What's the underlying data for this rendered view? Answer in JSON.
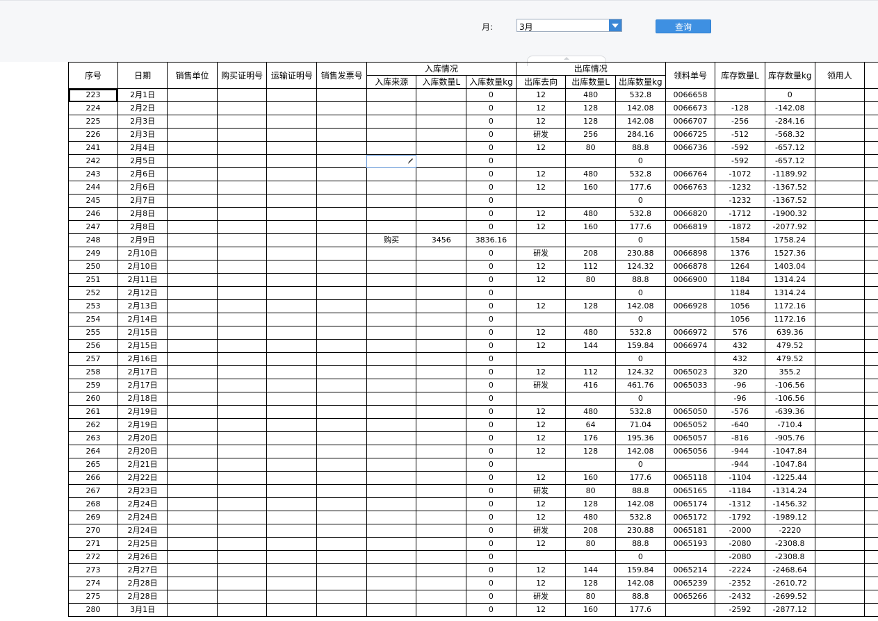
{
  "toolbar": {
    "month_label": "月:",
    "month_value": "3月",
    "query_label": "查询"
  },
  "headers": {
    "seq": "序号",
    "date": "日期",
    "sales_unit": "销售单位",
    "purchase_cert": "购买证明号",
    "transport_cert": "运输证明号",
    "invoice": "销售发票号",
    "inbound_group": "入库情况",
    "inbound_source": "入库来源",
    "inbound_qty_l": "入库数量L",
    "inbound_qty_kg": "入库数量kg",
    "outbound_group": "出库情况",
    "outbound_dest": "出库去向",
    "outbound_qty_l": "出库数量L",
    "outbound_qty_kg": "出库数量kg",
    "requisition": "领料单号",
    "stock_l": "库存数量L",
    "stock_kg": "库存数量kg",
    "receiver": "领用人"
  },
  "rows": [
    {
      "seq": "223",
      "date": "2月1日",
      "in_src": "",
      "in_l": "",
      "in_kg": "0",
      "out_dest": "12",
      "out_l": "480",
      "out_kg": "532.8",
      "req": "0066658",
      "stock_l": "",
      "stock_kg": "0"
    },
    {
      "seq": "224",
      "date": "2月2日",
      "in_src": "",
      "in_l": "",
      "in_kg": "0",
      "out_dest": "12",
      "out_l": "128",
      "out_kg": "142.08",
      "req": "0066673",
      "stock_l": "-128",
      "stock_kg": "-142.08"
    },
    {
      "seq": "225",
      "date": "2月3日",
      "in_src": "",
      "in_l": "",
      "in_kg": "0",
      "out_dest": "12",
      "out_l": "128",
      "out_kg": "142.08",
      "req": "0066707",
      "stock_l": "-256",
      "stock_kg": "-284.16"
    },
    {
      "seq": "226",
      "date": "2月3日",
      "in_src": "",
      "in_l": "",
      "in_kg": "0",
      "out_dest": "研发",
      "out_l": "256",
      "out_kg": "284.16",
      "req": "0066725",
      "stock_l": "-512",
      "stock_kg": "-568.32"
    },
    {
      "seq": "241",
      "date": "2月4日",
      "in_src": "",
      "in_l": "",
      "in_kg": "0",
      "out_dest": "12",
      "out_l": "80",
      "out_kg": "88.8",
      "req": "0066736",
      "stock_l": "-592",
      "stock_kg": "-657.12"
    },
    {
      "seq": "242",
      "date": "2月5日",
      "in_src": "",
      "in_l": "",
      "in_kg": "0",
      "out_dest": "",
      "out_l": "",
      "out_kg": "0",
      "req": "",
      "stock_l": "-592",
      "stock_kg": "-657.12"
    },
    {
      "seq": "243",
      "date": "2月6日",
      "in_src": "",
      "in_l": "",
      "in_kg": "0",
      "out_dest": "12",
      "out_l": "480",
      "out_kg": "532.8",
      "req": "0066764",
      "stock_l": "-1072",
      "stock_kg": "-1189.92"
    },
    {
      "seq": "244",
      "date": "2月6日",
      "in_src": "",
      "in_l": "",
      "in_kg": "0",
      "out_dest": "12",
      "out_l": "160",
      "out_kg": "177.6",
      "req": "0066763",
      "stock_l": "-1232",
      "stock_kg": "-1367.52"
    },
    {
      "seq": "245",
      "date": "2月7日",
      "in_src": "",
      "in_l": "",
      "in_kg": "0",
      "out_dest": "",
      "out_l": "",
      "out_kg": "0",
      "req": "",
      "stock_l": "-1232",
      "stock_kg": "-1367.52"
    },
    {
      "seq": "246",
      "date": "2月8日",
      "in_src": "",
      "in_l": "",
      "in_kg": "0",
      "out_dest": "12",
      "out_l": "480",
      "out_kg": "532.8",
      "req": "0066820",
      "stock_l": "-1712",
      "stock_kg": "-1900.32"
    },
    {
      "seq": "247",
      "date": "2月8日",
      "in_src": "",
      "in_l": "",
      "in_kg": "0",
      "out_dest": "12",
      "out_l": "160",
      "out_kg": "177.6",
      "req": "0066819",
      "stock_l": "-1872",
      "stock_kg": "-2077.92"
    },
    {
      "seq": "248",
      "date": "2月9日",
      "in_src": "购买",
      "in_l": "3456",
      "in_kg": "3836.16",
      "out_dest": "",
      "out_l": "",
      "out_kg": "0",
      "req": "",
      "stock_l": "1584",
      "stock_kg": "1758.24"
    },
    {
      "seq": "249",
      "date": "2月10日",
      "in_src": "",
      "in_l": "",
      "in_kg": "0",
      "out_dest": "研发",
      "out_l": "208",
      "out_kg": "230.88",
      "req": "0066898",
      "stock_l": "1376",
      "stock_kg": "1527.36"
    },
    {
      "seq": "250",
      "date": "2月10日",
      "in_src": "",
      "in_l": "",
      "in_kg": "0",
      "out_dest": "12",
      "out_l": "112",
      "out_kg": "124.32",
      "req": "0066878",
      "stock_l": "1264",
      "stock_kg": "1403.04"
    },
    {
      "seq": "251",
      "date": "2月11日",
      "in_src": "",
      "in_l": "",
      "in_kg": "0",
      "out_dest": "12",
      "out_l": "80",
      "out_kg": "88.8",
      "req": "0066900",
      "stock_l": "1184",
      "stock_kg": "1314.24"
    },
    {
      "seq": "252",
      "date": "2月12日",
      "in_src": "",
      "in_l": "",
      "in_kg": "0",
      "out_dest": "",
      "out_l": "",
      "out_kg": "0",
      "req": "",
      "stock_l": "1184",
      "stock_kg": "1314.24"
    },
    {
      "seq": "253",
      "date": "2月13日",
      "in_src": "",
      "in_l": "",
      "in_kg": "0",
      "out_dest": "12",
      "out_l": "128",
      "out_kg": "142.08",
      "req": "0066928",
      "stock_l": "1056",
      "stock_kg": "1172.16"
    },
    {
      "seq": "254",
      "date": "2月14日",
      "in_src": "",
      "in_l": "",
      "in_kg": "0",
      "out_dest": "",
      "out_l": "",
      "out_kg": "0",
      "req": "",
      "stock_l": "1056",
      "stock_kg": "1172.16"
    },
    {
      "seq": "255",
      "date": "2月15日",
      "in_src": "",
      "in_l": "",
      "in_kg": "0",
      "out_dest": "12",
      "out_l": "480",
      "out_kg": "532.8",
      "req": "0066972",
      "stock_l": "576",
      "stock_kg": "639.36"
    },
    {
      "seq": "256",
      "date": "2月15日",
      "in_src": "",
      "in_l": "",
      "in_kg": "0",
      "out_dest": "12",
      "out_l": "144",
      "out_kg": "159.84",
      "req": "0066974",
      "stock_l": "432",
      "stock_kg": "479.52"
    },
    {
      "seq": "257",
      "date": "2月16日",
      "in_src": "",
      "in_l": "",
      "in_kg": "0",
      "out_dest": "",
      "out_l": "",
      "out_kg": "0",
      "req": "",
      "stock_l": "432",
      "stock_kg": "479.52"
    },
    {
      "seq": "258",
      "date": "2月17日",
      "in_src": "",
      "in_l": "",
      "in_kg": "0",
      "out_dest": "12",
      "out_l": "112",
      "out_kg": "124.32",
      "req": "0065023",
      "stock_l": "320",
      "stock_kg": "355.2"
    },
    {
      "seq": "259",
      "date": "2月17日",
      "in_src": "",
      "in_l": "",
      "in_kg": "0",
      "out_dest": "研发",
      "out_l": "416",
      "out_kg": "461.76",
      "req": "0065033",
      "stock_l": "-96",
      "stock_kg": "-106.56"
    },
    {
      "seq": "260",
      "date": "2月18日",
      "in_src": "",
      "in_l": "",
      "in_kg": "0",
      "out_dest": "",
      "out_l": "",
      "out_kg": "0",
      "req": "",
      "stock_l": "-96",
      "stock_kg": "-106.56"
    },
    {
      "seq": "261",
      "date": "2月19日",
      "in_src": "",
      "in_l": "",
      "in_kg": "0",
      "out_dest": "12",
      "out_l": "480",
      "out_kg": "532.8",
      "req": "0065050",
      "stock_l": "-576",
      "stock_kg": "-639.36"
    },
    {
      "seq": "262",
      "date": "2月19日",
      "in_src": "",
      "in_l": "",
      "in_kg": "0",
      "out_dest": "12",
      "out_l": "64",
      "out_kg": "71.04",
      "req": "0065052",
      "stock_l": "-640",
      "stock_kg": "-710.4"
    },
    {
      "seq": "263",
      "date": "2月20日",
      "in_src": "",
      "in_l": "",
      "in_kg": "0",
      "out_dest": "12",
      "out_l": "176",
      "out_kg": "195.36",
      "req": "0065057",
      "stock_l": "-816",
      "stock_kg": "-905.76"
    },
    {
      "seq": "264",
      "date": "2月20日",
      "in_src": "",
      "in_l": "",
      "in_kg": "0",
      "out_dest": "12",
      "out_l": "128",
      "out_kg": "142.08",
      "req": "0065056",
      "stock_l": "-944",
      "stock_kg": "-1047.84"
    },
    {
      "seq": "265",
      "date": "2月21日",
      "in_src": "",
      "in_l": "",
      "in_kg": "0",
      "out_dest": "",
      "out_l": "",
      "out_kg": "0",
      "req": "",
      "stock_l": "-944",
      "stock_kg": "-1047.84"
    },
    {
      "seq": "266",
      "date": "2月22日",
      "in_src": "",
      "in_l": "",
      "in_kg": "0",
      "out_dest": "12",
      "out_l": "160",
      "out_kg": "177.6",
      "req": "0065118",
      "stock_l": "-1104",
      "stock_kg": "-1225.44"
    },
    {
      "seq": "267",
      "date": "2月23日",
      "in_src": "",
      "in_l": "",
      "in_kg": "0",
      "out_dest": "研发",
      "out_l": "80",
      "out_kg": "88.8",
      "req": "0065165",
      "stock_l": "-1184",
      "stock_kg": "-1314.24"
    },
    {
      "seq": "268",
      "date": "2月24日",
      "in_src": "",
      "in_l": "",
      "in_kg": "0",
      "out_dest": "12",
      "out_l": "128",
      "out_kg": "142.08",
      "req": "0065174",
      "stock_l": "-1312",
      "stock_kg": "-1456.32"
    },
    {
      "seq": "269",
      "date": "2月24日",
      "in_src": "",
      "in_l": "",
      "in_kg": "0",
      "out_dest": "12",
      "out_l": "480",
      "out_kg": "532.8",
      "req": "0065172",
      "stock_l": "-1792",
      "stock_kg": "-1989.12"
    },
    {
      "seq": "270",
      "date": "2月24日",
      "in_src": "",
      "in_l": "",
      "in_kg": "0",
      "out_dest": "研发",
      "out_l": "208",
      "out_kg": "230.88",
      "req": "0065181",
      "stock_l": "-2000",
      "stock_kg": "-2220"
    },
    {
      "seq": "271",
      "date": "2月25日",
      "in_src": "",
      "in_l": "",
      "in_kg": "0",
      "out_dest": "12",
      "out_l": "80",
      "out_kg": "88.8",
      "req": "0065193",
      "stock_l": "-2080",
      "stock_kg": "-2308.8"
    },
    {
      "seq": "272",
      "date": "2月26日",
      "in_src": "",
      "in_l": "",
      "in_kg": "0",
      "out_dest": "",
      "out_l": "",
      "out_kg": "0",
      "req": "",
      "stock_l": "-2080",
      "stock_kg": "-2308.8"
    },
    {
      "seq": "273",
      "date": "2月27日",
      "in_src": "",
      "in_l": "",
      "in_kg": "0",
      "out_dest": "12",
      "out_l": "144",
      "out_kg": "159.84",
      "req": "0065214",
      "stock_l": "-2224",
      "stock_kg": "-2468.64"
    },
    {
      "seq": "274",
      "date": "2月28日",
      "in_src": "",
      "in_l": "",
      "in_kg": "0",
      "out_dest": "12",
      "out_l": "128",
      "out_kg": "142.08",
      "req": "0065239",
      "stock_l": "-2352",
      "stock_kg": "-2610.72"
    },
    {
      "seq": "275",
      "date": "2月28日",
      "in_src": "",
      "in_l": "",
      "in_kg": "0",
      "out_dest": "研发",
      "out_l": "80",
      "out_kg": "88.8",
      "req": "0065266",
      "stock_l": "-2432",
      "stock_kg": "-2699.52"
    },
    {
      "seq": "280",
      "date": "3月1日",
      "in_src": "",
      "in_l": "",
      "in_kg": "0",
      "out_dest": "12",
      "out_l": "160",
      "out_kg": "177.6",
      "req": "",
      "stock_l": "-2592",
      "stock_kg": "-2877.12"
    }
  ]
}
